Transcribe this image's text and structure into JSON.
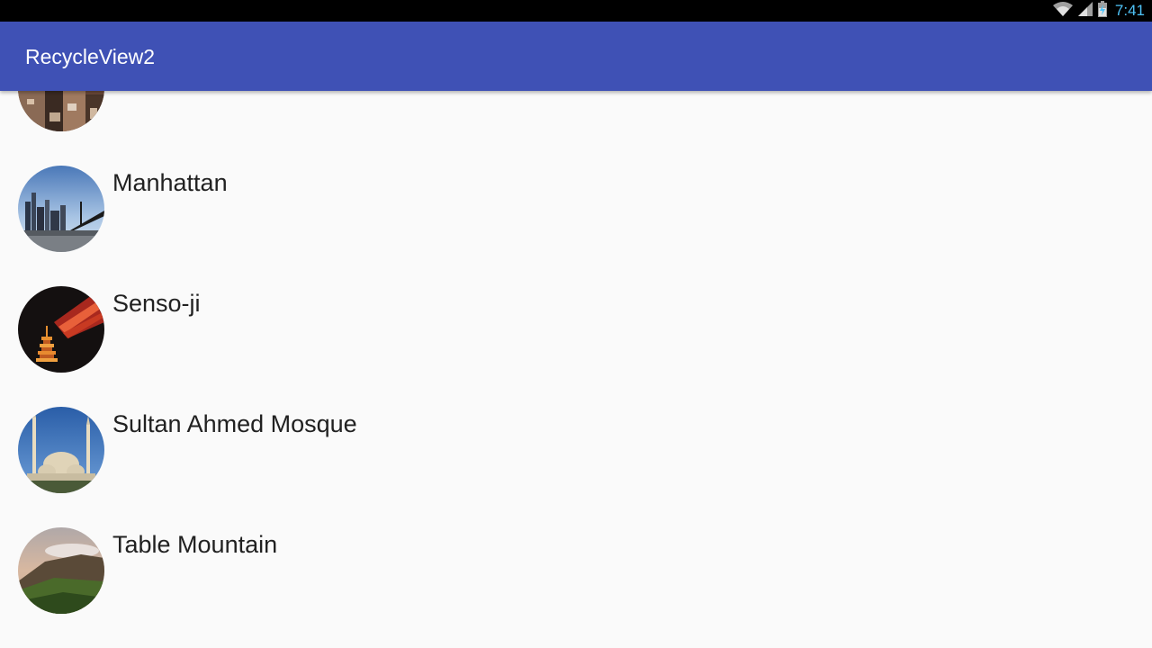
{
  "status_bar": {
    "time": "7:41",
    "icons": [
      "wifi-icon",
      "signal-icon",
      "battery-icon"
    ],
    "time_color": "#4fc3f7"
  },
  "app_bar": {
    "title": "RecycleView2",
    "color": "#3f51b5"
  },
  "list": {
    "items": [
      {
        "label": "",
        "image": "city-aerial-photo"
      },
      {
        "label": "Manhattan",
        "image": "manhattan-photo"
      },
      {
        "label": "Senso-ji",
        "image": "senso-ji-photo"
      },
      {
        "label": "Sultan Ahmed Mosque",
        "image": "mosque-photo"
      },
      {
        "label": "Table Mountain",
        "image": "table-mountain-photo"
      }
    ]
  }
}
